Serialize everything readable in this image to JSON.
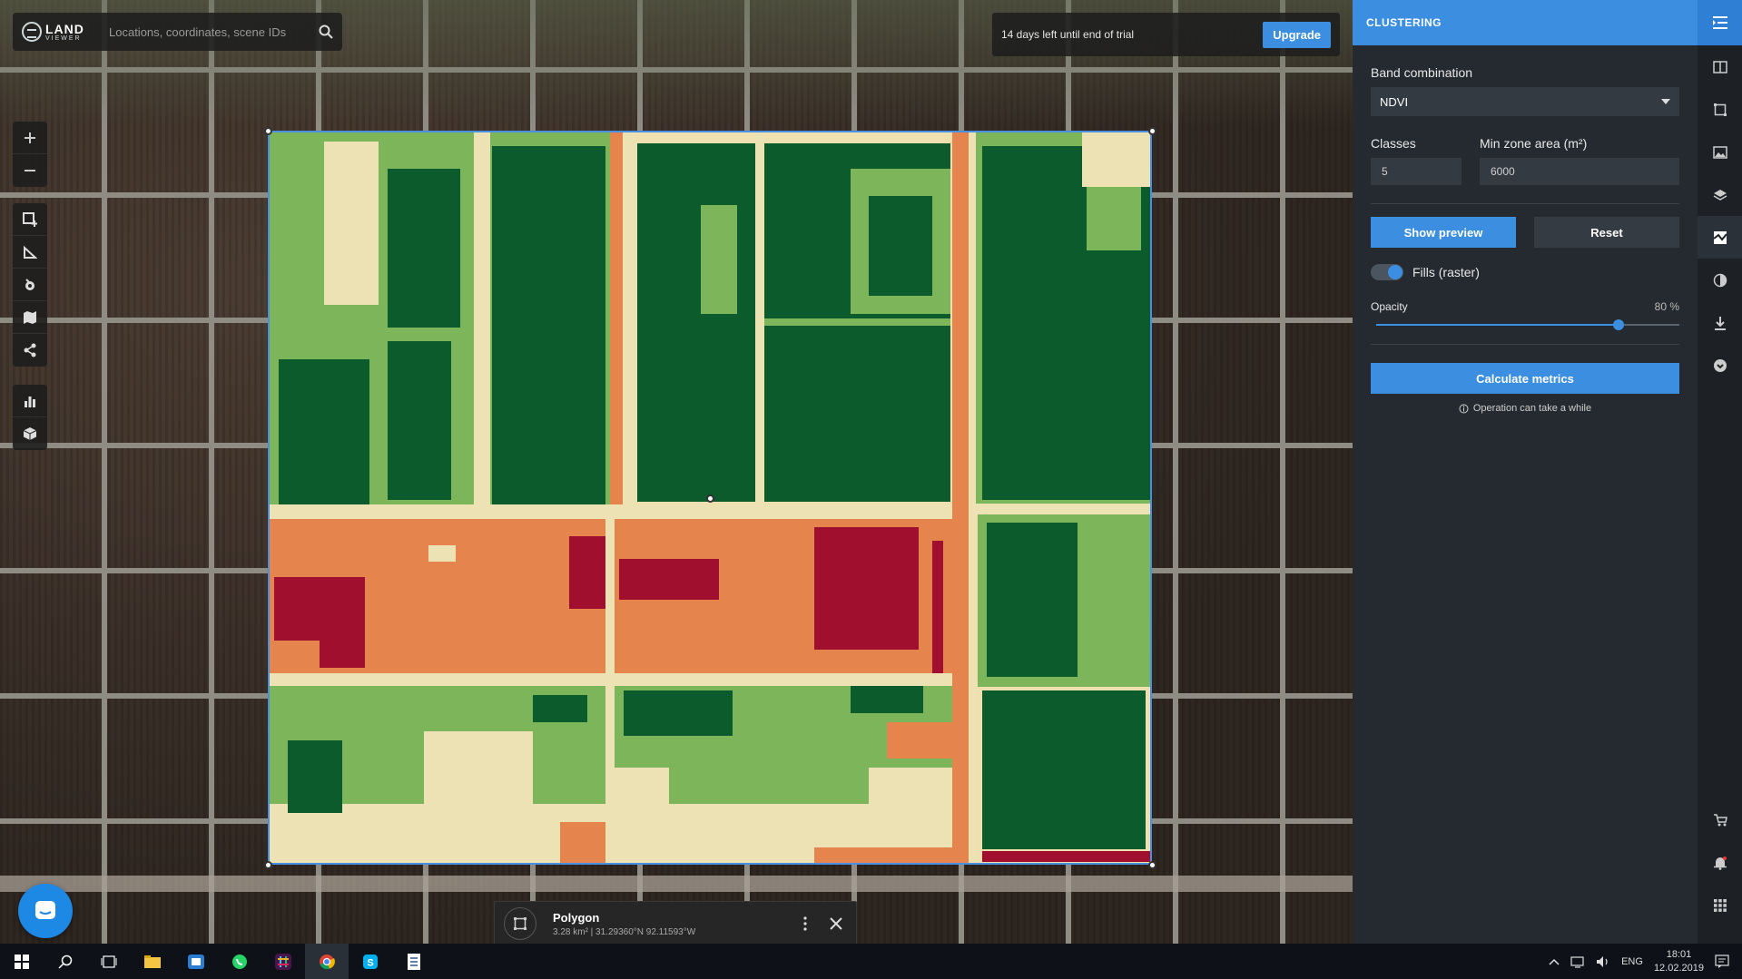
{
  "app": {
    "logo_main": "LAND",
    "logo_sub": "VIEWER"
  },
  "search": {
    "placeholder": "Locations, coordinates, scene IDs"
  },
  "trial": {
    "text": "14 days left until end of trial",
    "upgrade_label": "Upgrade"
  },
  "panel": {
    "title": "CLUSTERING",
    "band_label": "Band combination",
    "band_value": "NDVI",
    "classes_label": "Classes",
    "classes_value": "5",
    "min_zone_label": "Min zone area (m²)",
    "min_zone_value": "6000",
    "show_preview_label": "Show preview",
    "reset_label": "Reset",
    "fills_label": "Fills (raster)",
    "fills_on": true,
    "opacity_label": "Opacity",
    "opacity_value": 80,
    "opacity_text": "80 %",
    "calc_label": "Calculate metrics",
    "note": "Operation can take a while"
  },
  "polygon": {
    "title": "Polygon",
    "info": "3.28 km² | 31.29360°N 92.11593°W"
  },
  "clustering_colors": {
    "class1": "#0c5b2c",
    "class2": "#7db65a",
    "class3": "#ede2b3",
    "class4": "#e6844e",
    "class5": "#a0102e"
  },
  "taskbar": {
    "lang": "ENG",
    "time": "18:01",
    "date": "12.02.2019"
  },
  "accent": "#3b8ee0"
}
